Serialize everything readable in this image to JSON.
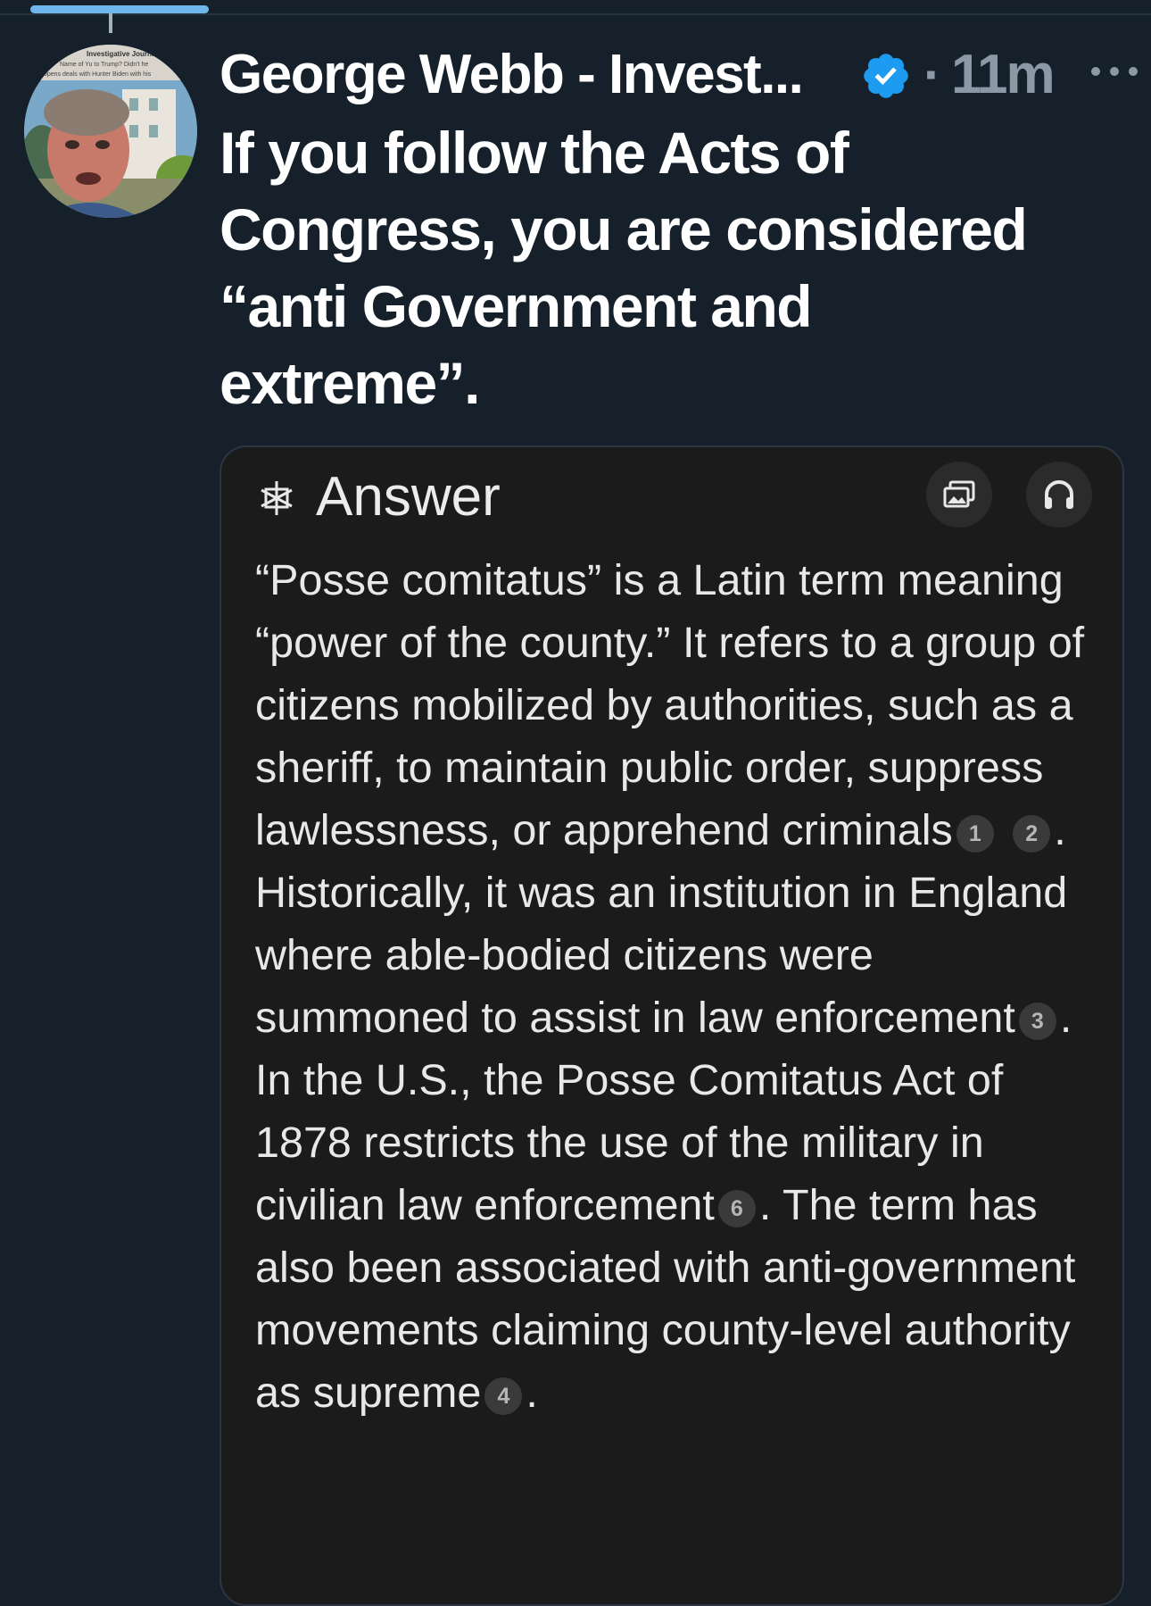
{
  "tweet": {
    "author_name": "George Webb - Invest...",
    "time_ago": "11m",
    "text": "If you follow the Acts of Congress, you are considered “anti Government and extreme”.",
    "avatar_caption": {
      "line1": "Investigative Journalist",
      "line2": "Name of Yu to Trump? Didn't he",
      "line3": "opens deals with Hunter Biden with his"
    }
  },
  "answer_card": {
    "title": "Answer",
    "segments": [
      "“Posse comitatus” is a Latin term meaning “power of the county.” It refers to a group of citizens mobilized by authorities, such as a sheriff, to maintain public order, suppress lawlessness, or apprehend criminals",
      ". Historically, it was an institution in England where able-bodied citizens were summoned to assist in law enforcement",
      ". In the U.S., the Posse Comitatus Act of 1878 restricts the use of the military in civilian law enforcement",
      ". The term has also been associated with anti-government movements claiming county-level authority as supreme",
      "."
    ],
    "citations": [
      "1",
      "2",
      "3",
      "6",
      "4"
    ]
  },
  "colors": {
    "background": "#15202b",
    "card_background": "#1b1b1b",
    "verified_badge": "#1d9bf0",
    "accent_bar": "#6fb7ea"
  },
  "icons": {
    "verified": "verified-badge-icon",
    "more": "more-options-icon",
    "answer": "answer-logo-icon",
    "image": "image-gallery-icon",
    "audio": "headphones-icon"
  }
}
